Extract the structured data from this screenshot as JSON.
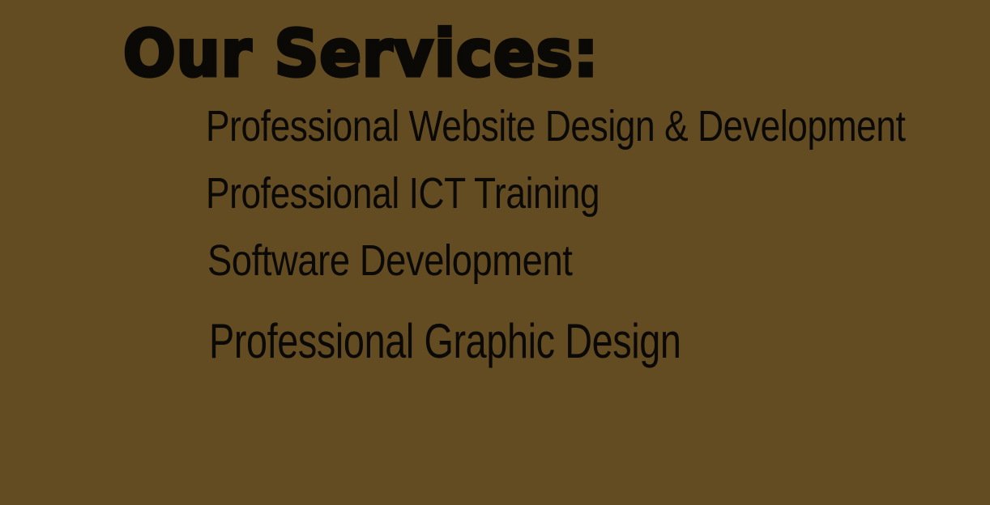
{
  "banner": {
    "title": "Our Services:",
    "services": [
      "Professional Website Design & Development",
      "Professional ICT Training",
      "Software Development",
      "Professional Graphic Design"
    ],
    "colors": {
      "background": "#634c22",
      "text": "#0a0906"
    }
  }
}
